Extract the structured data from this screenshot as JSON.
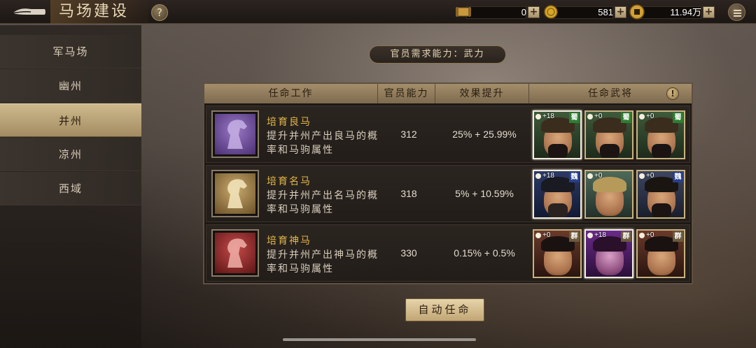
{
  "header": {
    "title": "马场建设",
    "help_label": "?",
    "resources": [
      {
        "name": "scroll-resource",
        "icon": "scroll-icon",
        "value": "0"
      },
      {
        "name": "gold-resource",
        "icon": "gold-coin-icon",
        "value": "581"
      },
      {
        "name": "copper-resource",
        "icon": "copper-coin-icon",
        "value": "11.94万"
      }
    ],
    "plus_label": "+"
  },
  "sidebar": {
    "items": [
      {
        "label": "军马场",
        "active": false
      },
      {
        "label": "幽州",
        "active": false
      },
      {
        "label": "并州",
        "active": true
      },
      {
        "label": "凉州",
        "active": false
      },
      {
        "label": "西域",
        "active": false
      }
    ]
  },
  "requirement": "官员需求能力：武力",
  "table": {
    "headers": [
      "任命工作",
      "官员能力",
      "效果提升",
      "任命武将"
    ],
    "warn_label": "!",
    "rows": [
      {
        "title": "培育良马",
        "desc": "提升并州产出良马的概率和马驹属性",
        "ability": "312",
        "effect": "25% + 25.99%",
        "icon_color": "#7a5aa8",
        "generals": [
          {
            "level": "+18",
            "faction": "蜀",
            "faction_color": "#2e7d32",
            "selected": true
          },
          {
            "level": "+0",
            "faction": "蜀",
            "faction_color": "#2e7d32",
            "selected": false
          },
          {
            "level": "+0",
            "faction": "蜀",
            "faction_color": "#2e7d32",
            "selected": false
          }
        ]
      },
      {
        "title": "培育名马",
        "desc": "提升并州产出名马的概率和马驹属性",
        "ability": "318",
        "effect": "5% + 10.59%",
        "icon_color": "#a48a55",
        "generals": [
          {
            "level": "+18",
            "faction": "魏",
            "faction_color": "#283f8a",
            "selected": true
          },
          {
            "level": "+0",
            "faction": "魏",
            "faction_color": "#283f8a",
            "selected": false
          },
          {
            "level": "+0",
            "faction": "魏",
            "faction_color": "#283f8a",
            "selected": false
          }
        ]
      },
      {
        "title": "培育神马",
        "desc": "提升并州产出神马的概率和马驹属性",
        "ability": "330",
        "effect": "0.15% + 0.5%",
        "icon_color": "#a83a3a",
        "generals": [
          {
            "level": "+0",
            "faction": "群",
            "faction_color": "#6b5a3e",
            "selected": false
          },
          {
            "level": "+18",
            "faction": "群",
            "faction_color": "#6b5a3e",
            "selected": true
          },
          {
            "level": "+0",
            "faction": "群",
            "faction_color": "#6b5a3e",
            "selected": false
          }
        ]
      }
    ]
  },
  "auto_button": "自动任命"
}
